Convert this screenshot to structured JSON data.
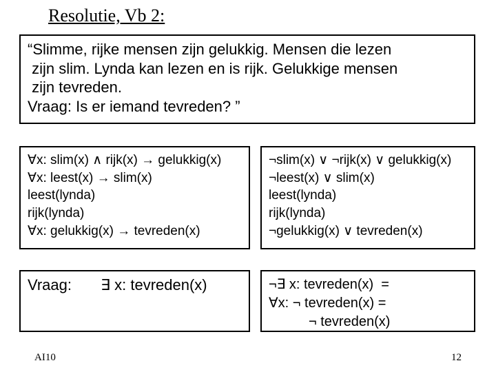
{
  "title": "Resolutie, Vb 2:",
  "intro": {
    "l1": "“Slimme, rijke mensen zijn gelukkig. Mensen die lezen",
    "l2": " zijn slim. Lynda kan lezen en is rijk. Gelukkige mensen",
    "l3": " zijn tevreden.",
    "l4": "Vraag: Is er iemand tevreden? ”"
  },
  "left1": {
    "l1": "∀x: slim(x) ∧ rijk(x) → gelukkig(x)",
    "l2": "∀x: leest(x) → slim(x)",
    "l3": "leest(lynda)",
    "l4": "rijk(lynda)",
    "l5": "∀x: gelukkig(x) → tevreden(x)"
  },
  "right1": {
    "l1": "¬slim(x) ∨ ¬rijk(x) ∨ gelukkig(x)",
    "l2": "¬leest(x) ∨ slim(x)",
    "l3": "leest(lynda)",
    "l4": "rijk(lynda)",
    "l5": "¬gelukkig(x) ∨ tevreden(x)"
  },
  "left2": {
    "labelVraag": "Vraag:",
    "expr": "∃ x: tevreden(x)"
  },
  "right2": {
    "l1": "¬∃ x: tevreden(x)  =",
    "l2": "∀x: ¬ tevreden(x) =",
    "l3": "¬ tevreden(x)"
  },
  "footer": {
    "left": "AI10",
    "right": "12"
  }
}
